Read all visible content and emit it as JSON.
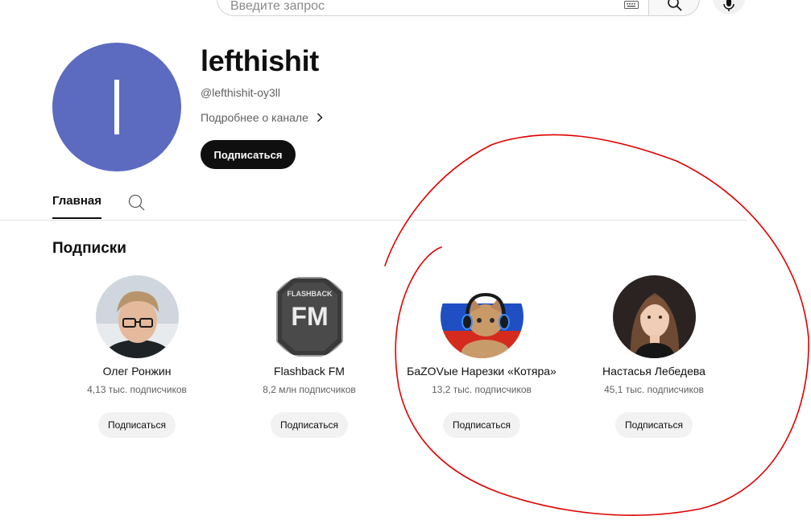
{
  "search": {
    "placeholder": "Введите запрос"
  },
  "channel": {
    "avatar_letter": "l",
    "name": "lefthishit",
    "handle": "@lefthishit-oy3ll",
    "more_label": "Подробнее о канале",
    "subscribe_label": "Подписаться",
    "avatar_color": "#5c6bc0"
  },
  "tabs": {
    "home": "Главная"
  },
  "section": {
    "title": "Подписки",
    "items": [
      {
        "name": "Олег Ронжин",
        "subscribers": "4,13 тыс. подписчиков",
        "button": "Подписаться"
      },
      {
        "name": "Flashback FM",
        "subscribers": "8,2 млн подписчиков",
        "button": "Подписаться"
      },
      {
        "name": "БаZOVые Нарезки «Котяра»",
        "subscribers": "13,2 тыс. подписчиков",
        "button": "Подписаться"
      },
      {
        "name": "Настасья Лебедева",
        "subscribers": "45,1 тыс. подписчиков",
        "button": "Подписаться"
      }
    ]
  },
  "flashback_logo": {
    "top": "FLASHBACK",
    "mark": "FM"
  },
  "annotation_color": "#e00000"
}
